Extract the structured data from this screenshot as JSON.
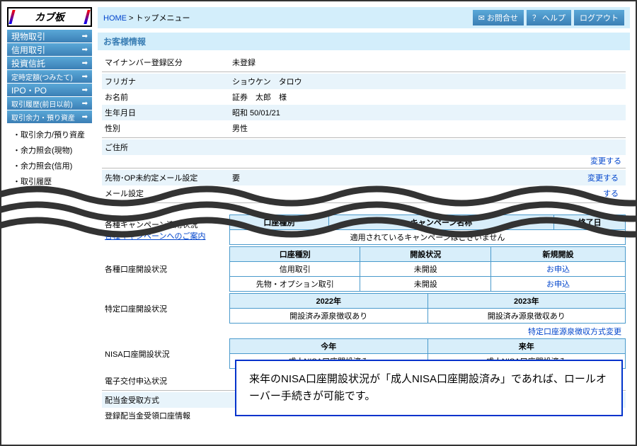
{
  "logo": "カブ板",
  "nav": {
    "items": [
      "現物取引",
      "信用取引",
      "投資信託",
      "定時定額(つみたて)",
      "IPO・PO",
      "取引履歴(前日以前)",
      "取引余力・預り資産"
    ],
    "sub": [
      "取引余力/預り資産",
      "余力照会(現物)",
      "余力照会(信用)",
      "取引履歴"
    ]
  },
  "breadcrumb": {
    "home": "HOME",
    "sep": " > ",
    "current": "トップメニュー"
  },
  "header_btns": {
    "contact": "✉ お問合せ",
    "help": "？ ヘルプ",
    "logout": "ログアウト"
  },
  "section_title": "お客様情報",
  "info": {
    "mynumber_label": "マイナンバー登録区分",
    "mynumber": "未登録",
    "furigana_label": "フリガナ",
    "furigana": "ショウケン　タロウ",
    "name_label": "お名前",
    "name": "証券　太郎　様",
    "birth_label": "生年月日",
    "birth": "昭和 50/01/21",
    "sex_label": "性別",
    "sex": "男性",
    "address_label": "ご住所",
    "sakimono_label": "先物･OP未約定メール設定",
    "sakimono_value": "要",
    "mail_label": "メール設定"
  },
  "change": "変更する",
  "campaign": {
    "row_label": "各種キャンペーン適用状況",
    "link": "各種キャンペーンへのご案内",
    "h1": "口座種別",
    "h2": "キャンペーン名称",
    "h3": "終了日",
    "none": "適用されているキャンペーンはございません"
  },
  "accounts": {
    "row_label": "各種口座開設状況",
    "h_type": "口座種別",
    "h_status": "開設状況",
    "h_new": "新規開設",
    "r1_type": "信用取引",
    "r1_status": "未開設",
    "r1_new": "お申込",
    "r2_type": "先物・オプション取引",
    "r2_status": "未開設",
    "r2_new": "お申込"
  },
  "tokutei": {
    "row_label": "特定口座開設状況",
    "y1": "2022年",
    "y2": "2023年",
    "s1": "開設済み源泉徴収あり",
    "s2": "開設済み源泉徴収あり",
    "link": "特定口座源泉徴収方式変更"
  },
  "nisa": {
    "row_label": "NISA口座開設状況",
    "h_this": "今年",
    "h_next": "来年",
    "this": "成人NISA口座開設済み",
    "next": "成人NISA口座開設済み"
  },
  "extra": {
    "denshi": "電子交付申込状況",
    "haitou": "配当金受取方式",
    "touroku": "登録配当金受領口座情報"
  },
  "callout": "来年のNISA口座開設状況が「成人NISA口座開設済み」であれば、ロールオーバー手続きが可能です。"
}
